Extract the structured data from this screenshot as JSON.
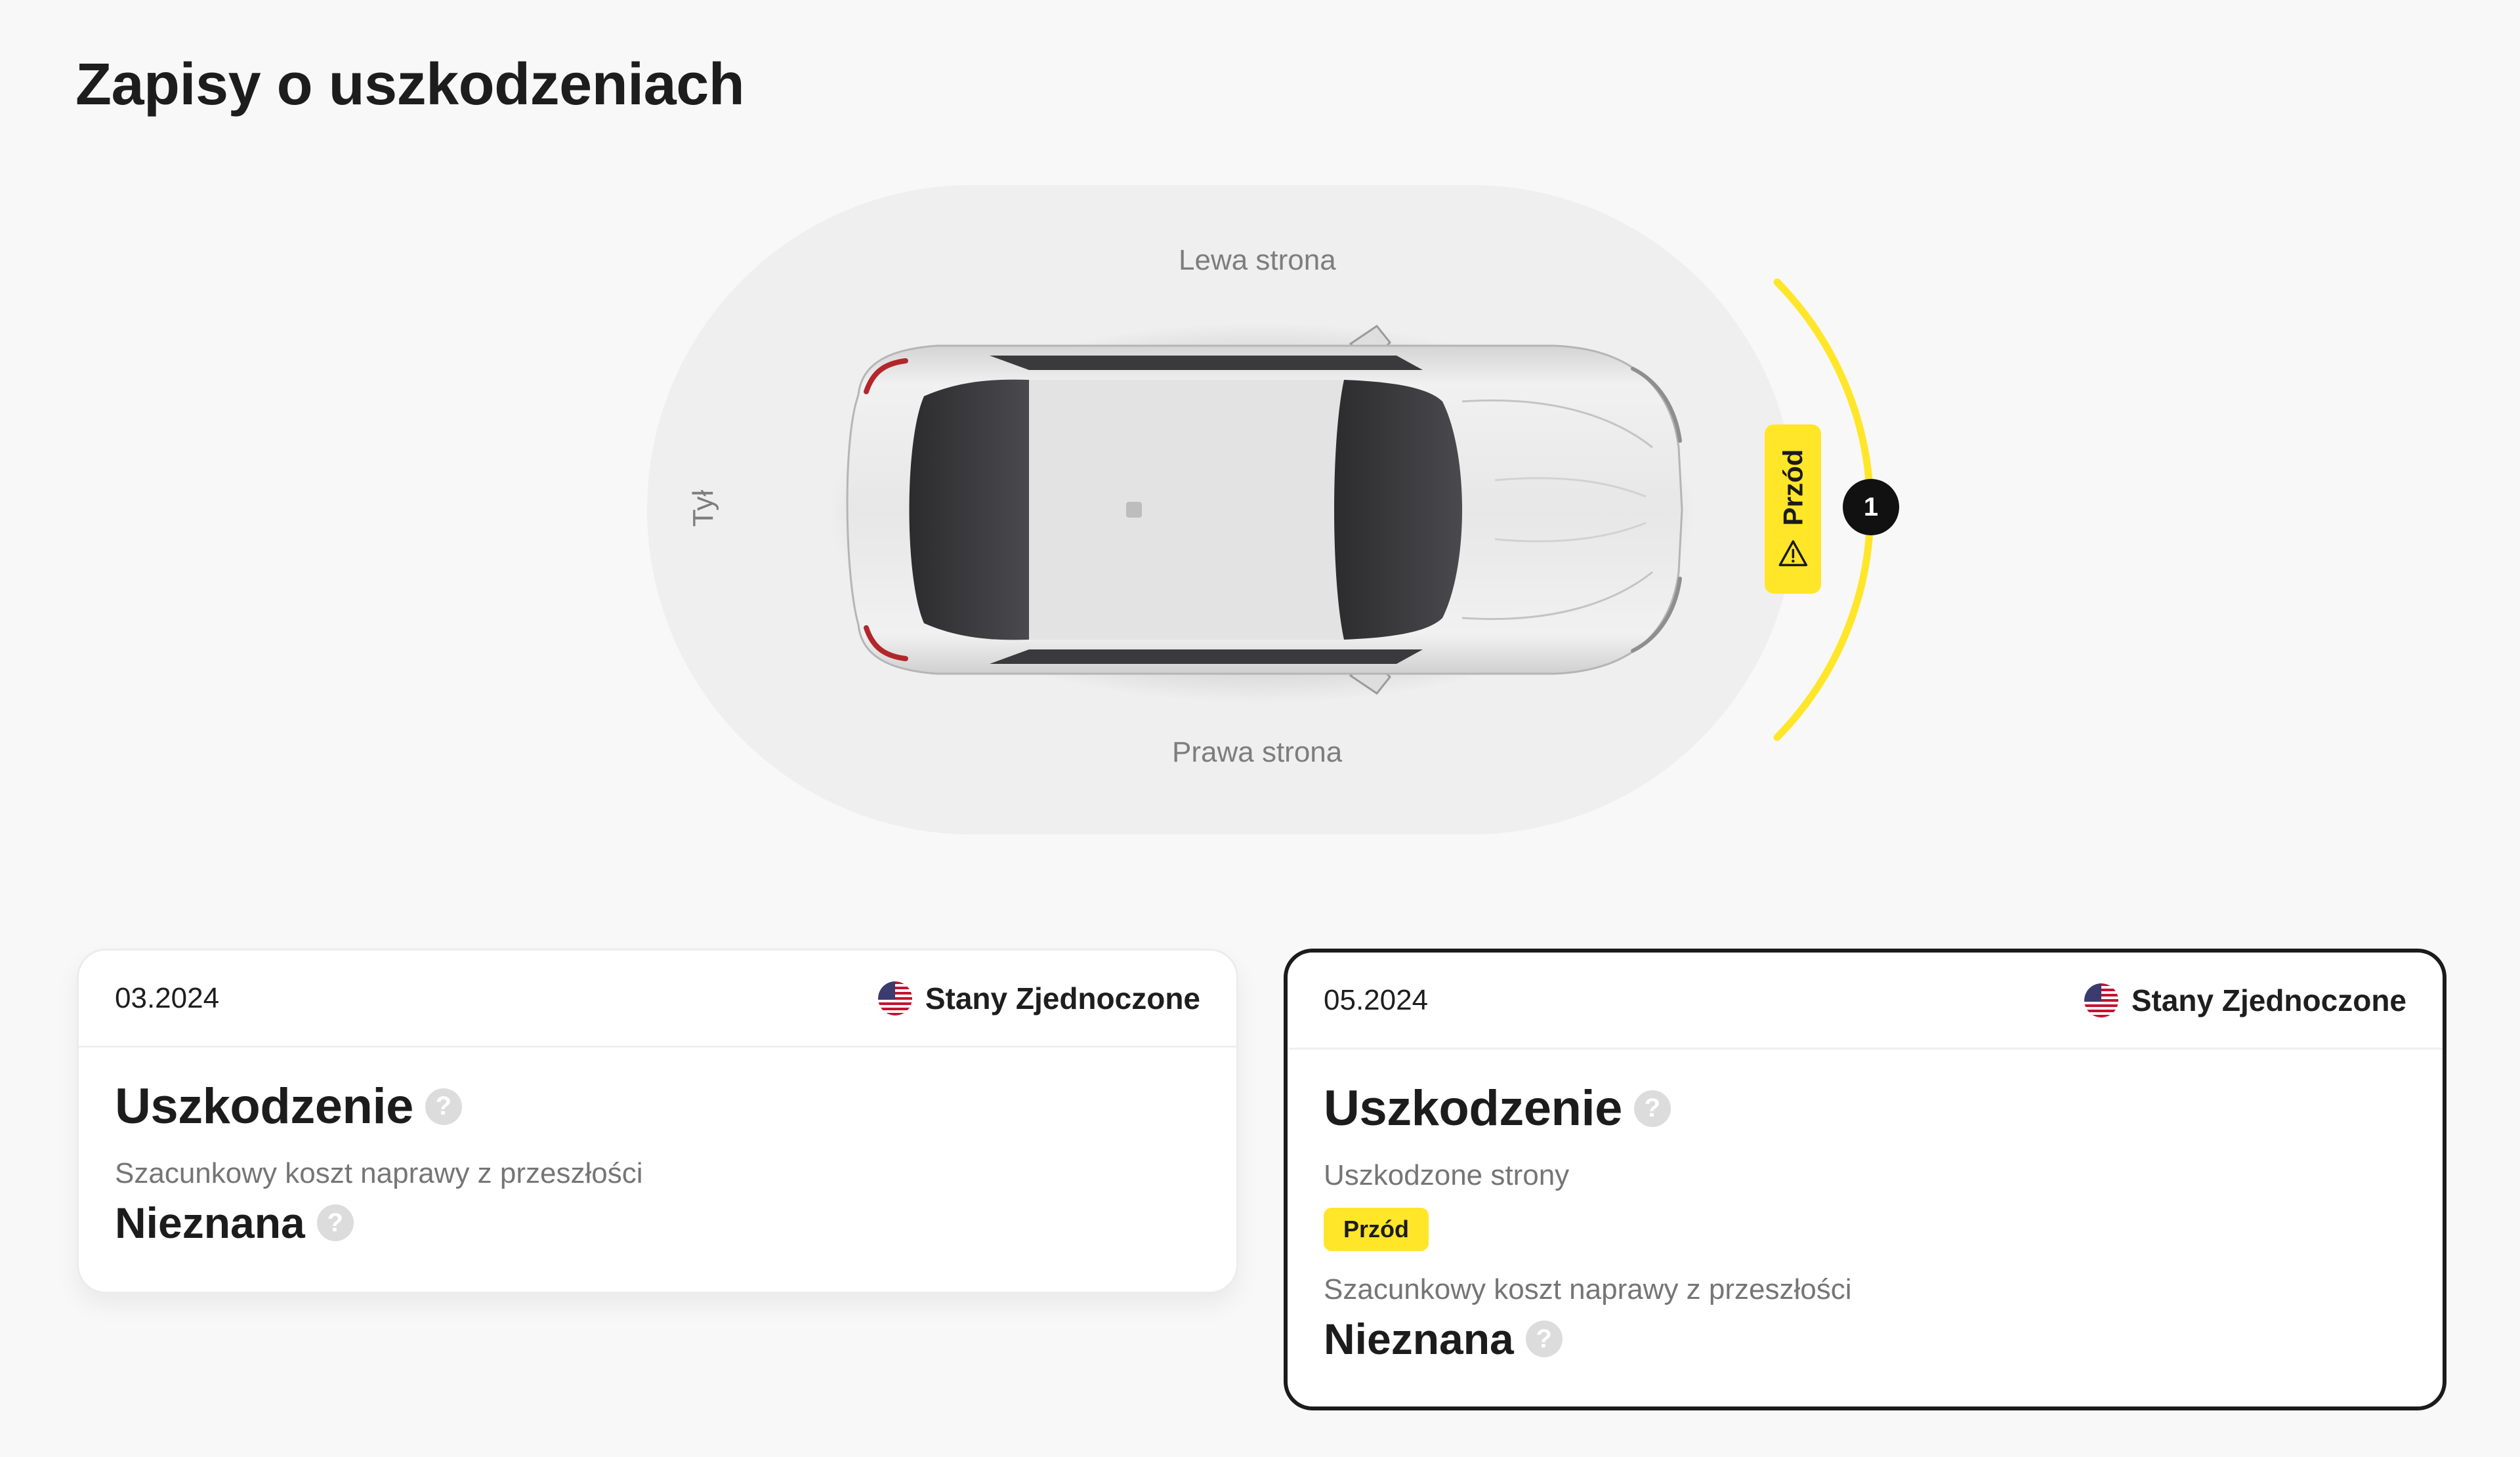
{
  "page": {
    "title": "Zapisy o uszkodzeniach"
  },
  "diagram": {
    "labels": {
      "left": "Lewa strona",
      "right": "Prawa strona",
      "rear": "Tył"
    },
    "front_tag": {
      "label": "Przód",
      "icon": "warning-icon"
    },
    "damage_count": "1",
    "colors": {
      "highlight": "#FFE629",
      "track": "#EFEFEF",
      "badge": "#111111"
    }
  },
  "records": [
    {
      "date": "03.2024",
      "country": "Stany Zjednoczone",
      "flag_icon": "us-flag-icon",
      "title": "Uszkodzenie",
      "cost_label": "Szacunkowy koszt naprawy z przeszłości",
      "cost_value": "Nieznana"
    },
    {
      "date": "05.2024",
      "country": "Stany Zjednoczone",
      "flag_icon": "us-flag-icon",
      "title": "Uszkodzenie",
      "sides_label": "Uszkodzone strony",
      "sides": [
        "Przód"
      ],
      "cost_label": "Szacunkowy koszt naprawy z przeszłości",
      "cost_value": "Nieznana"
    }
  ]
}
